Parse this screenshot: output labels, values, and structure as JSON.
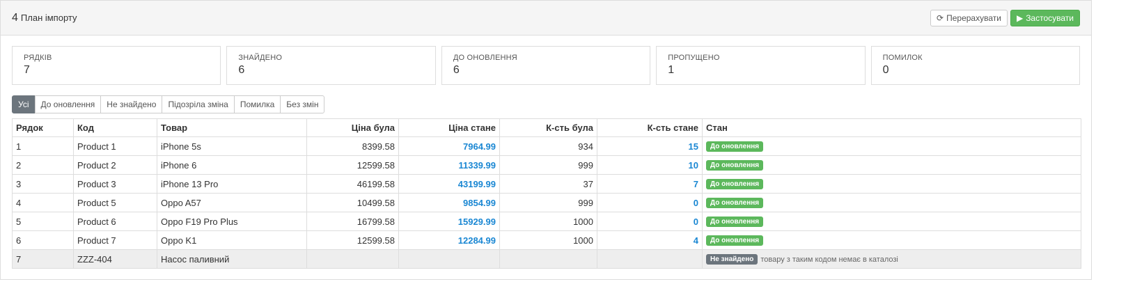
{
  "header": {
    "step": "4",
    "title": "План імпорту",
    "recalc_label": "Перерахувати",
    "apply_label": "Застосувати"
  },
  "stats": [
    {
      "label": "Рядків",
      "value": "7"
    },
    {
      "label": "Знайдено",
      "value": "6"
    },
    {
      "label": "До оновлення",
      "value": "6"
    },
    {
      "label": "Пропущено",
      "value": "1"
    },
    {
      "label": "Помилок",
      "value": "0"
    }
  ],
  "filters": [
    "Усі",
    "До оновлення",
    "Не знайдено",
    "Підозріла зміна",
    "Помилка",
    "Без змін"
  ],
  "table": {
    "headers": [
      "Рядок",
      "Код",
      "Товар",
      "Ціна була",
      "Ціна стане",
      "К-сть була",
      "К-сть стане",
      "Стан"
    ],
    "rows": [
      {
        "row": "1",
        "code": "Product 1",
        "product": "iPhone 5s",
        "price_was": "8399.58",
        "price_new": "7964.99",
        "qty_was": "934",
        "qty_new": "15",
        "status": "До оновлення",
        "note": ""
      },
      {
        "row": "2",
        "code": "Product 2",
        "product": "iPhone 6",
        "price_was": "12599.58",
        "price_new": "11339.99",
        "qty_was": "999",
        "qty_new": "10",
        "status": "До оновлення",
        "note": ""
      },
      {
        "row": "3",
        "code": "Product 3",
        "product": "iPhone 13 Pro",
        "price_was": "46199.58",
        "price_new": "43199.99",
        "qty_was": "37",
        "qty_new": "7",
        "status": "До оновлення",
        "note": ""
      },
      {
        "row": "4",
        "code": "Product 5",
        "product": "Oppo A57",
        "price_was": "10499.58",
        "price_new": "9854.99",
        "qty_was": "999",
        "qty_new": "0",
        "status": "До оновлення",
        "note": ""
      },
      {
        "row": "5",
        "code": "Product 6",
        "product": "Oppo F19 Pro Plus",
        "price_was": "16799.58",
        "price_new": "15929.99",
        "qty_was": "1000",
        "qty_new": "0",
        "status": "До оновлення",
        "note": ""
      },
      {
        "row": "6",
        "code": "Product 7",
        "product": "Oppo K1",
        "price_was": "12599.58",
        "price_new": "12284.99",
        "qty_was": "1000",
        "qty_new": "4",
        "status": "До оновлення",
        "note": ""
      },
      {
        "row": "7",
        "code": "ZZZ-404",
        "product": "Насос паливний",
        "price_was": "",
        "price_new": "",
        "qty_was": "",
        "qty_new": "",
        "status": "Не знайдено",
        "note": "товару з таким кодом немає в каталозі"
      }
    ]
  },
  "colors": {
    "success": "#5cb85c",
    "secondary": "#6c757d",
    "accent_blue": "#1a87d3"
  }
}
